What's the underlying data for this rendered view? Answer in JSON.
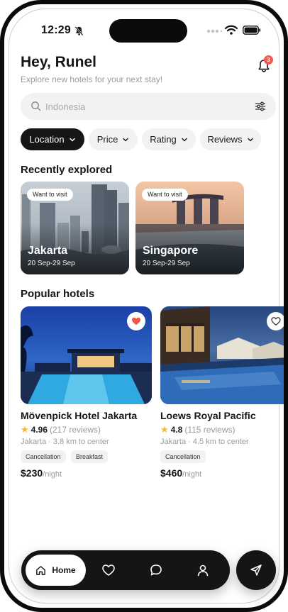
{
  "status": {
    "time": "12:29"
  },
  "header": {
    "greeting": "Hey, Runel",
    "subtitle": "Explore new hotels for your next stay!",
    "notification_count": "3"
  },
  "search": {
    "placeholder": "Indonesia"
  },
  "filters": [
    {
      "label": "Location",
      "active": true
    },
    {
      "label": "Price",
      "active": false
    },
    {
      "label": "Rating",
      "active": false
    },
    {
      "label": "Reviews",
      "active": false
    }
  ],
  "recent": {
    "title": "Recently explored",
    "items": [
      {
        "tag": "Want to visit",
        "city": "Jakarta",
        "dates": "20 Sep-29 Sep"
      },
      {
        "tag": "Want to visit",
        "city": "Singapore",
        "dates": "20 Sep-29 Sep"
      }
    ]
  },
  "popular": {
    "title": "Popular hotels",
    "items": [
      {
        "name": "Mövenpick Hotel Jakarta",
        "rating": "4.96",
        "reviews": "(217 reviews)",
        "distance": "Jakarta · 3.8 km to center",
        "tags": [
          "Cancellation",
          "Breakfast"
        ],
        "price": "$230",
        "per": "/night",
        "favorited": true
      },
      {
        "name": "Loews Royal Pacific",
        "rating": "4.8",
        "reviews": "(115 reviews)",
        "distance": "Jakarta · 4.5 km to center",
        "tags": [
          "Cancellation"
        ],
        "price": "$460",
        "per": "/night",
        "favorited": false
      }
    ]
  },
  "nav": {
    "home_label": "Home"
  },
  "colors": {
    "accent": "#161616",
    "badge": "#ef5a4c",
    "star": "#f5b82e",
    "heart": "#ef5a4c"
  }
}
